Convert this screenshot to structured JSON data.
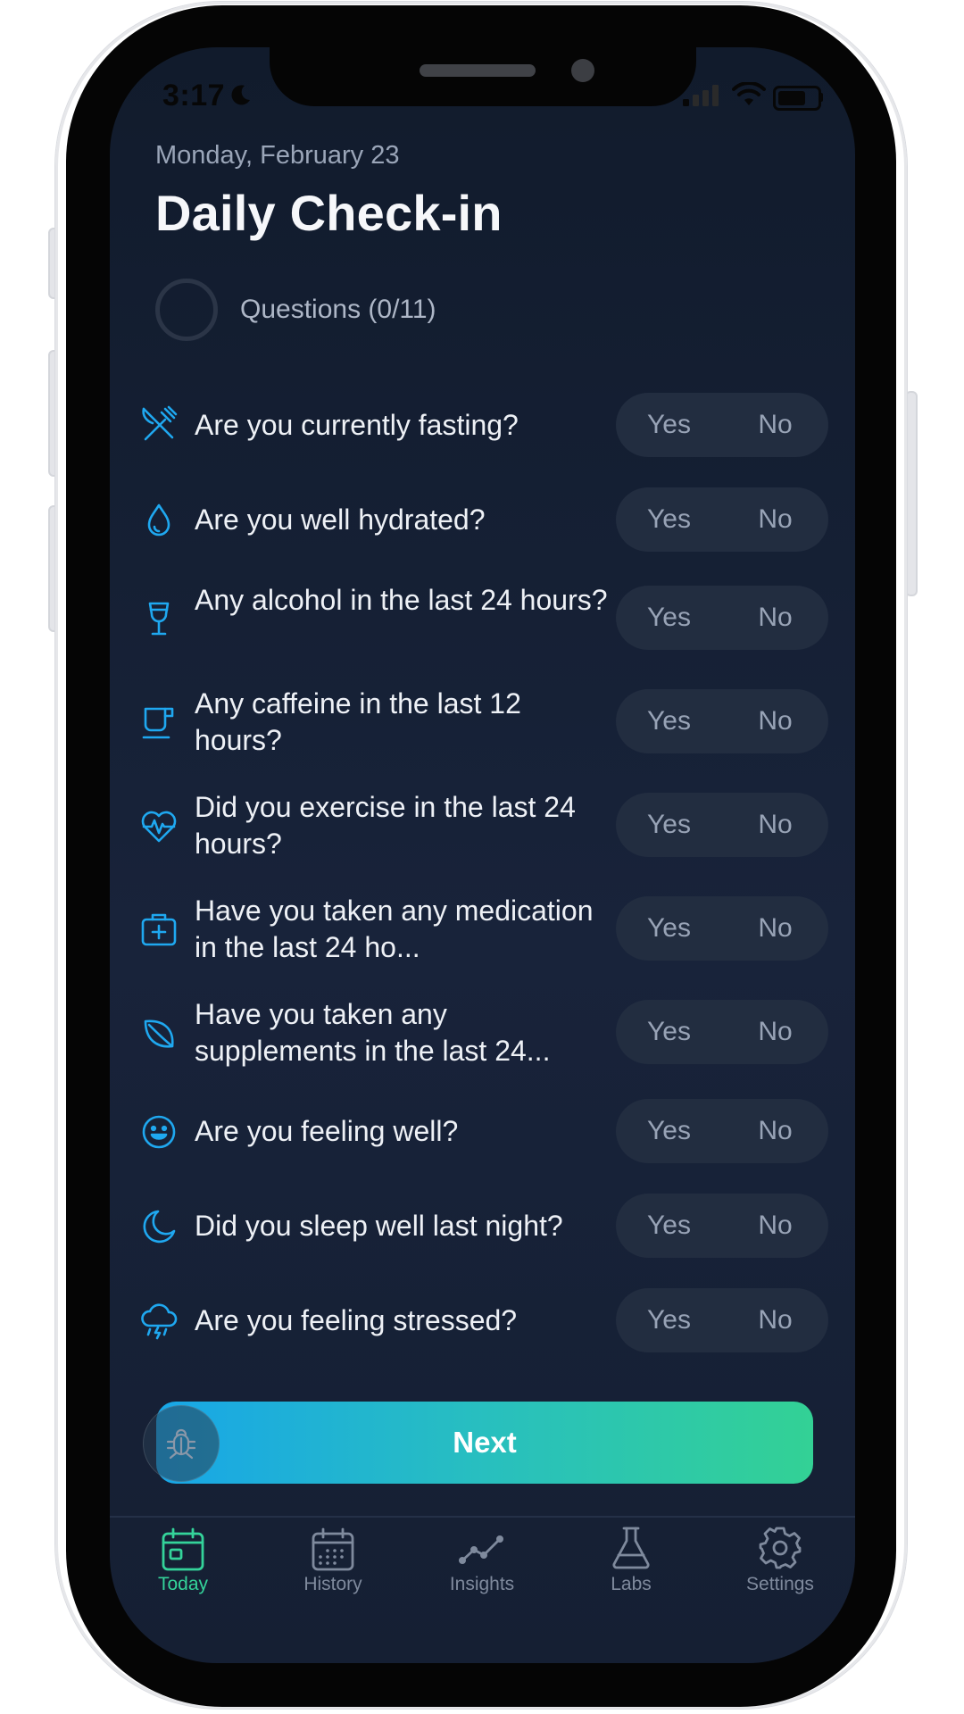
{
  "status_bar": {
    "time": "3:17"
  },
  "header": {
    "date": "Monday, February 23",
    "title": "Daily Check-in",
    "progress_label": "Questions (0/11)"
  },
  "questions": [
    {
      "icon": "utensils-icon",
      "text": "Are you currently fasting?",
      "yes": "Yes",
      "no": "No"
    },
    {
      "icon": "water-drop-icon",
      "text": "Are you well hydrated?",
      "yes": "Yes",
      "no": "No"
    },
    {
      "icon": "wine-glass-icon",
      "text": "Any alcohol in the last 24 hours?",
      "yes": "Yes",
      "no": "No"
    },
    {
      "icon": "coffee-cup-icon",
      "text": "Any caffeine in the last 12 hours?",
      "yes": "Yes",
      "no": "No"
    },
    {
      "icon": "heart-pulse-icon",
      "text": "Did you exercise in the last 24 hours?",
      "yes": "Yes",
      "no": "No"
    },
    {
      "icon": "medical-kit-icon",
      "text": "Have you taken any medication in the last 24 ho...",
      "yes": "Yes",
      "no": "No"
    },
    {
      "icon": "leaf-icon",
      "text": "Have you taken any supplements in the last 24...",
      "yes": "Yes",
      "no": "No"
    },
    {
      "icon": "smile-icon",
      "text": "Are you feeling well?",
      "yes": "Yes",
      "no": "No"
    },
    {
      "icon": "moon-icon",
      "text": "Did you sleep well last night?",
      "yes": "Yes",
      "no": "No"
    },
    {
      "icon": "storm-cloud-icon",
      "text": "Are you feeling stressed?",
      "yes": "Yes",
      "no": "No"
    }
  ],
  "next_button": {
    "label": "Next"
  },
  "tabs": [
    {
      "label": "Today",
      "icon": "calendar-today-icon",
      "active": true
    },
    {
      "label": "History",
      "icon": "calendar-grid-icon",
      "active": false
    },
    {
      "label": "Insights",
      "icon": "trend-line-icon",
      "active": false
    },
    {
      "label": "Labs",
      "icon": "flask-icon",
      "active": false
    },
    {
      "label": "Settings",
      "icon": "gear-icon",
      "active": false
    }
  ],
  "colors": {
    "accent": "#34d39a",
    "icon_blue": "#1fa8f0",
    "gradient_start": "#18a6e8",
    "gradient_end": "#33d195"
  }
}
